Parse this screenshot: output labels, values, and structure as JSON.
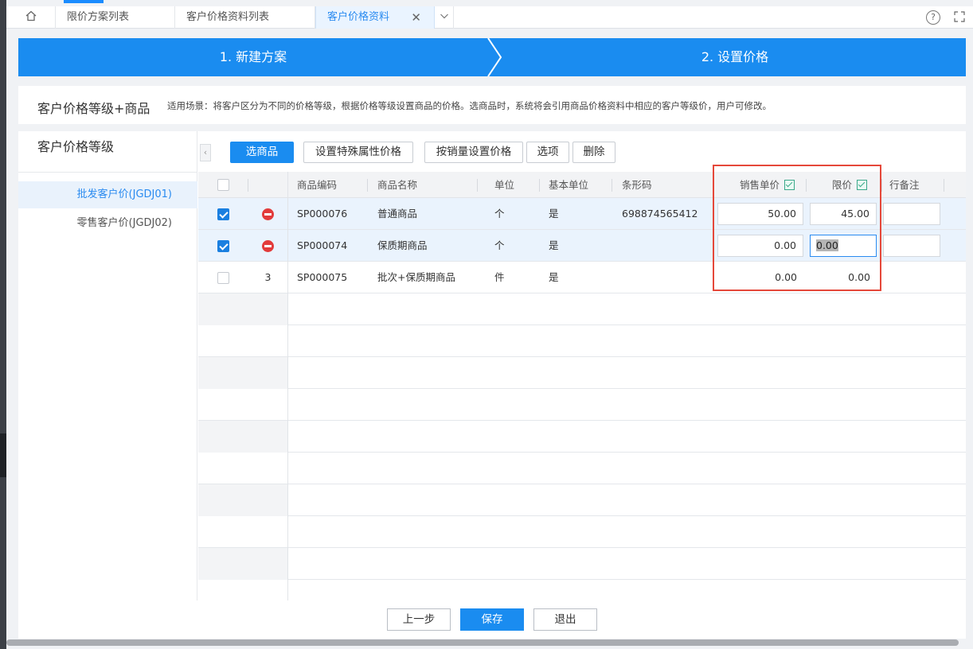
{
  "tabs": {
    "home_icon": "home-icon",
    "items": [
      {
        "label": "限价方案列表"
      },
      {
        "label": "客户价格资料列表"
      },
      {
        "label": "客户价格资料",
        "active": true
      }
    ],
    "close_glyph": "✕"
  },
  "steps": [
    {
      "label": "1. 新建方案"
    },
    {
      "label": "2. 设置价格"
    }
  ],
  "intro": {
    "title": "客户价格等级+商品",
    "description": "适用场景：将客户区分为不同的价格等级，根据价格等级设置商品的价格。选商品时，系统将会引用商品价格资料中相应的客户等级价，用户可修改。"
  },
  "sidebar": {
    "title": "客户价格等级",
    "items": [
      {
        "label": "批发客户价(JGDJ01)",
        "active": true
      },
      {
        "label": "零售客户价(JGDJ02)",
        "active": false
      }
    ]
  },
  "toolbar": {
    "select_goods": "选商品",
    "special_attr_price": "设置特殊属性价格",
    "sales_volume_price": "按销量设置价格",
    "options": "选项",
    "delete": "删除"
  },
  "table": {
    "columns": {
      "code": "商品编码",
      "name": "商品名称",
      "unit": "单位",
      "base_unit": "基本单位",
      "barcode": "条形码",
      "sale_price": "销售单价",
      "limit_price": "限价",
      "remark": "行备注"
    },
    "rows": [
      {
        "checked": true,
        "action": "remove",
        "code": "SP000076",
        "name": "普通商品",
        "unit": "个",
        "base_unit": "是",
        "barcode": "698874565412",
        "sale_price": "50.00",
        "limit_price": "45.00",
        "remark": ""
      },
      {
        "checked": true,
        "action": "remove",
        "code": "SP000074",
        "name": "保质期商品",
        "unit": "个",
        "base_unit": "是",
        "barcode": "",
        "sale_price": "0.00",
        "limit_price": "0.00",
        "remark": ""
      },
      {
        "checked": false,
        "index": "3",
        "code": "SP000075",
        "name": "批次+保质期商品",
        "unit": "件",
        "base_unit": "是",
        "barcode": "",
        "sale_price": "0.00",
        "limit_price": "0.00",
        "remark": ""
      }
    ]
  },
  "footer": {
    "prev": "上一步",
    "save": "保存",
    "exit": "退出"
  },
  "colors": {
    "accent": "#1a8cf0",
    "highlight_box": "#e5483a",
    "delete_icon": "#e23b3b"
  }
}
